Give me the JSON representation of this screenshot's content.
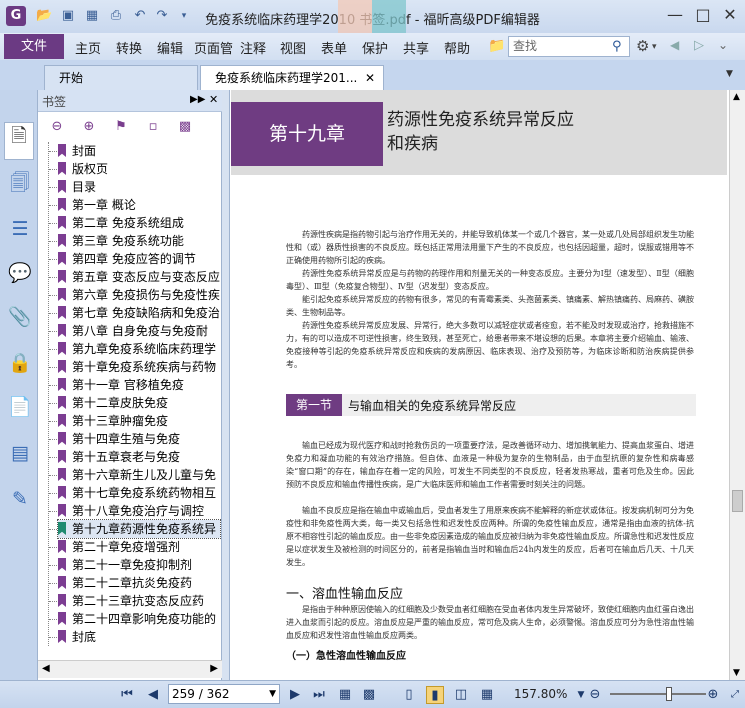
{
  "app": {
    "title": "免疫系统临床药理学2010 书签.pdf - 福昕高级PDF编辑器",
    "logo_letter": "G",
    "search_placeholder": "查找"
  },
  "menu": {
    "file": "文件",
    "items": [
      "主页",
      "转换",
      "编辑",
      "页面管",
      "注释",
      "视图",
      "表单",
      "保护",
      "共享",
      "帮助"
    ]
  },
  "tabs": [
    {
      "label": "开始"
    },
    {
      "label": "免疫系统临床药理学201..."
    }
  ],
  "sidebar": {
    "title": "书签"
  },
  "bookmarks": [
    "封面",
    "版权页",
    "目录",
    "第一章 概论",
    "第二章 免疫系统组成",
    "第三章 免疫系统功能",
    "第四章 免疫应答的调节",
    "第五章 变态反应与变态反应",
    "第六章 免疫损伤与免疫性疾",
    "第七章 免疫缺陷病和免疫治",
    "第八章 自身免疫与免疫耐",
    "第九章免疫系统临床药理学",
    "第十章免疫系统疾病与药物",
    "第十一章 官移植免疫",
    "第十二章皮肤免疫",
    "第十三章肿瘤免疫",
    "第十四章生殖与免疫",
    "第十五章衰老与免疫",
    "第十六章新生儿及儿童与免",
    "第十七章免疫系统药物相互",
    "第十八章免疫治疗与调控",
    "第十九章药源性免疫系统异",
    "第二十章免疫增强剂",
    "第二十一章免疫抑制剂",
    "第二十二章抗炎免疫药",
    "第二十三章抗变态反应药",
    "第二十四章影响免疫功能的",
    "封底"
  ],
  "selected_bookmark": 21,
  "document": {
    "chapter_label": "第十九章",
    "chapter_title": "药源性免疫系统异常反应\n和疾病",
    "p1": "药源性疾病是指药物引起与治疗作用无关的，并能导致机体某一个或几个器官，某一处或几处局部组织发生功能性和（或）器质性损害的不良反应。既包括正常用法用量下产生的不良反应，也包括因超量，超时，误服或错用等不正确使用药物所引起的疾病。",
    "p2": "药源性免疫系统异常反应是与药物的药理作用和剂量无关的一种变态反应。主要分为Ⅰ型（速发型）、Ⅱ型（细胞毒型）、Ⅲ型（免疫复合物型）、Ⅳ型（迟发型）变态反应。",
    "p3": "能引起免疫系统异常反应的药物有很多，常见的有青霉素类、头孢菌素类、镇痛素、解热镇痛药、局麻药、磺胺类、生物制品等。",
    "p4": "药源性免疫系统异常反应发展、异常行，绝大多数可以减轻症状或者痊愈，若不能及时发现或治疗，抢救措施不力，有的可以造成不可逆性损害，终生致残，甚至死亡，给患者带来不堪设想的后果。本章将主要介绍输血、输液、免疫接种等引起的免疫系统异常反应和疾病的发病原因、临床表现、治疗及预防等，为临床诊断和防治疾病提供参考。",
    "section_label": "第一节",
    "section_title": "与输血相关的免疫系统异常反应",
    "p5": "输血已经成为现代医疗和战时抢救伤员的一项重要疗法，是改善循环动力、增加携氧能力、提高血浆蛋白、增进免疫力和凝血功能的有效治疗措施。但自体、血液是一种极为复杂的生物制品，由于血型抗原的复杂性和病毒感染“窗口期”的存在，输血存在着一定的风险，可发生不同类型的不良反应，轻者发热寒战，重者可危及生命。因此预防不良反应和输血传播性疾病，是广大临床医师和输血工作者需要时刻关注的问题。",
    "p6": "输血不良反应是指在输血中或输血后，受血者发生了用原来疾病不能解释的新症状或体征。按发病机制可分为免疫性和非免疫性两大类，每一类又包括急性和迟发性反应两种。所谓的免疫性输血反应，通常是指由血液的抗体-抗原不相容性引起的输血反应。由一些非免疫因素造成的输血反应被归纳为非免疫性输血反应。所谓急性和迟发性反应是以症状发生及被检测的时间区分的，前者是指输血当时和输血后24h内发生的反应，后者可在输血后几天、十几天发生。",
    "sub1": "一、溶血性输血反应",
    "p7": "是指由于种种原因使输入的红细胞及少数受血者红细胞在受血者体内发生异常破坏，致使红细胞内血红蛋白逸出进入血浆而引起的反应。溶血反应是严重的输血反应，常可危及病人生命，必须警惕。溶血反应可分为急性溶血性输血反应和迟发性溶血性输血反应两类。",
    "sub2": "（一）急性溶血性输血反应"
  },
  "status": {
    "page": "259 / 362",
    "zoom": "157.80%"
  }
}
